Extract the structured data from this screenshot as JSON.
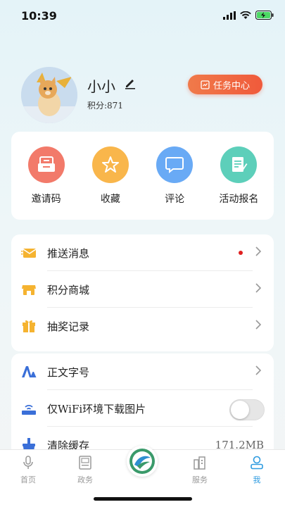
{
  "status": {
    "time": "10:39"
  },
  "profile": {
    "name": "小小",
    "points": "积分:871",
    "task_button": "任务中心"
  },
  "quick_actions": [
    {
      "label": "邀请码",
      "icon": "invite-icon",
      "color": "#f27a6a"
    },
    {
      "label": "收藏",
      "icon": "star-icon",
      "color": "#f9b64b"
    },
    {
      "label": "评论",
      "icon": "comment-icon",
      "color": "#69aaf5"
    },
    {
      "label": "活动报名",
      "icon": "signup-icon",
      "color": "#5dcfba"
    }
  ],
  "menu1": [
    {
      "label": "推送消息",
      "icon": "mail-icon"
    },
    {
      "label": "积分商城",
      "icon": "shop-icon"
    },
    {
      "label": "抽奖记录",
      "icon": "gift-icon"
    }
  ],
  "menu2": [
    {
      "label": "正文字号",
      "icon": "font-size-icon"
    },
    {
      "label": "仅WiFi环境下载图片",
      "icon": "wifi-router-icon"
    },
    {
      "label": "清除缓存",
      "icon": "clear-cache-icon",
      "value": "171.2MB"
    }
  ],
  "tabs": [
    {
      "label": "首页"
    },
    {
      "label": "政务"
    },
    {
      "label": "服务"
    },
    {
      "label": "我"
    }
  ],
  "colors": {
    "accent": "#2e9be0",
    "task_button": "#f05a3b",
    "menu_icon": "#f5b330",
    "setting_icon": "#3a6fd8"
  }
}
